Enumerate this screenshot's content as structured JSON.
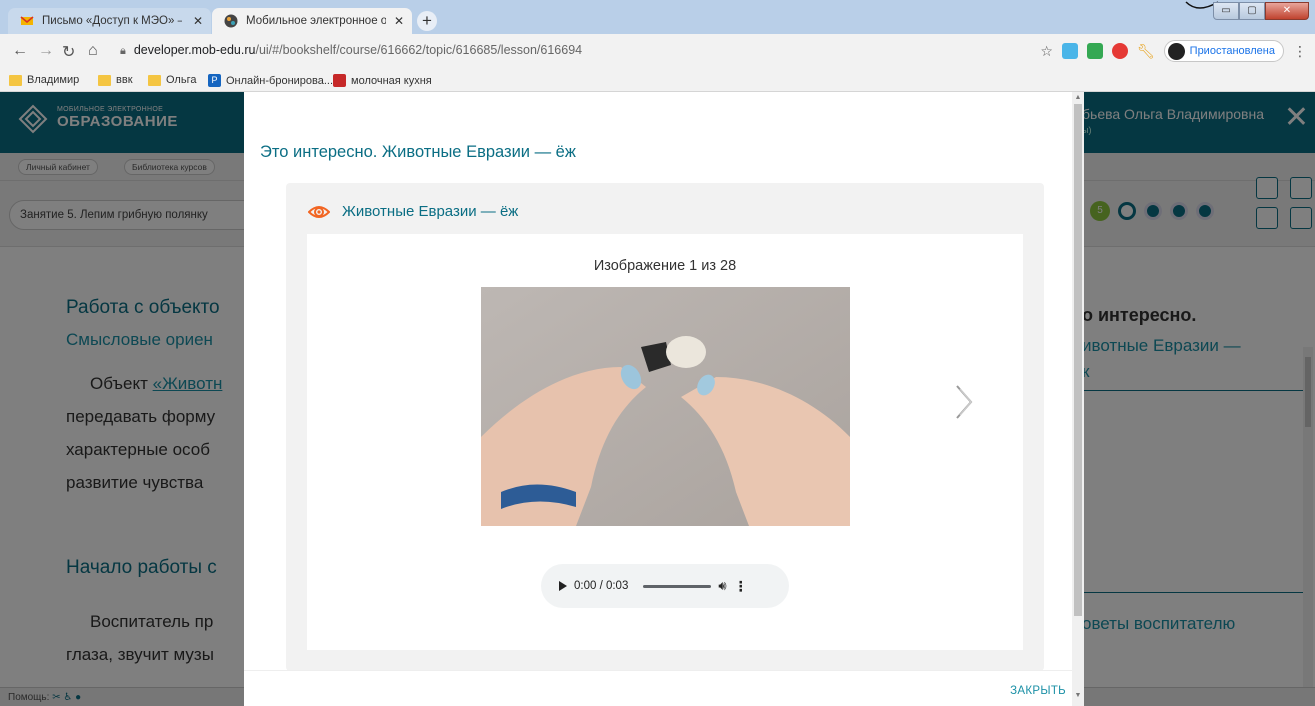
{
  "browser": {
    "tabs": [
      {
        "title": "Письмо «Доступ к МЭО» — Ро",
        "close": "✕",
        "active": false
      },
      {
        "title": "Мобильное электронное обра",
        "close": "✕",
        "active": true
      }
    ],
    "new_tab": "+",
    "window_buttons": {
      "minimize": "▭",
      "maximize": "▢",
      "close": "✕"
    },
    "url_host": "developer.mob-edu.ru",
    "url_path": "/ui/#/bookshelf/course/616662/topic/616685/lesson/616694",
    "profile_label": "Приостановлена",
    "bookmarks": [
      "Владимир",
      "ввк",
      "Ольга",
      "Онлайн-бронирова...",
      "молочная кухня"
    ],
    "bookmark_icon_letter": "P"
  },
  "site": {
    "logo_small": "МОБИЛЬНОЕ ЭЛЕКТРОННОЕ",
    "logo_big": "ОБРАЗОВАНИЕ",
    "user_name": "бьева Ольга Владимировна",
    "user_sub": "ы)",
    "close": "✕",
    "breadcrumbs": [
      "Личный кабинет",
      "Библиотека курсов"
    ],
    "lesson_title": "Занятие 5. Лепим грибную полянку",
    "lesson_step_number": "5",
    "bg_heading1": "Работа с объекто",
    "bg_subheading1": "Смысловые ориен",
    "bg_para1_prefix": "Объект ",
    "bg_para1_link": "«Животн",
    "bg_para1_l2": "передавать форму",
    "bg_para1_l3": "характерные особ",
    "bg_para1_l4": "развитие чувства",
    "bg_heading2": "Начало работы с",
    "bg_para2_l1": "Воспитатель пр",
    "bg_para2_l2": "глаза, звучит музы",
    "right_heading": "о интересно.",
    "right_sub_l1": "ивотные Евразии —",
    "right_sub_l2": "к",
    "right_advice": "оветы воспитателю",
    "status_text": "Помощь:"
  },
  "modal": {
    "title": "Это интересно. Животные Евразии — ёж",
    "card_title": "Животные Евразии — ёж",
    "counter": "Изображение 1 из 28",
    "audio_time": "0:00 / 0:03",
    "close_label": "ЗАКРЫТЬ"
  },
  "colors": {
    "brand_teal": "#0b6e84",
    "accent_link": "#1b90a6",
    "eye_orange": "#f26522"
  }
}
